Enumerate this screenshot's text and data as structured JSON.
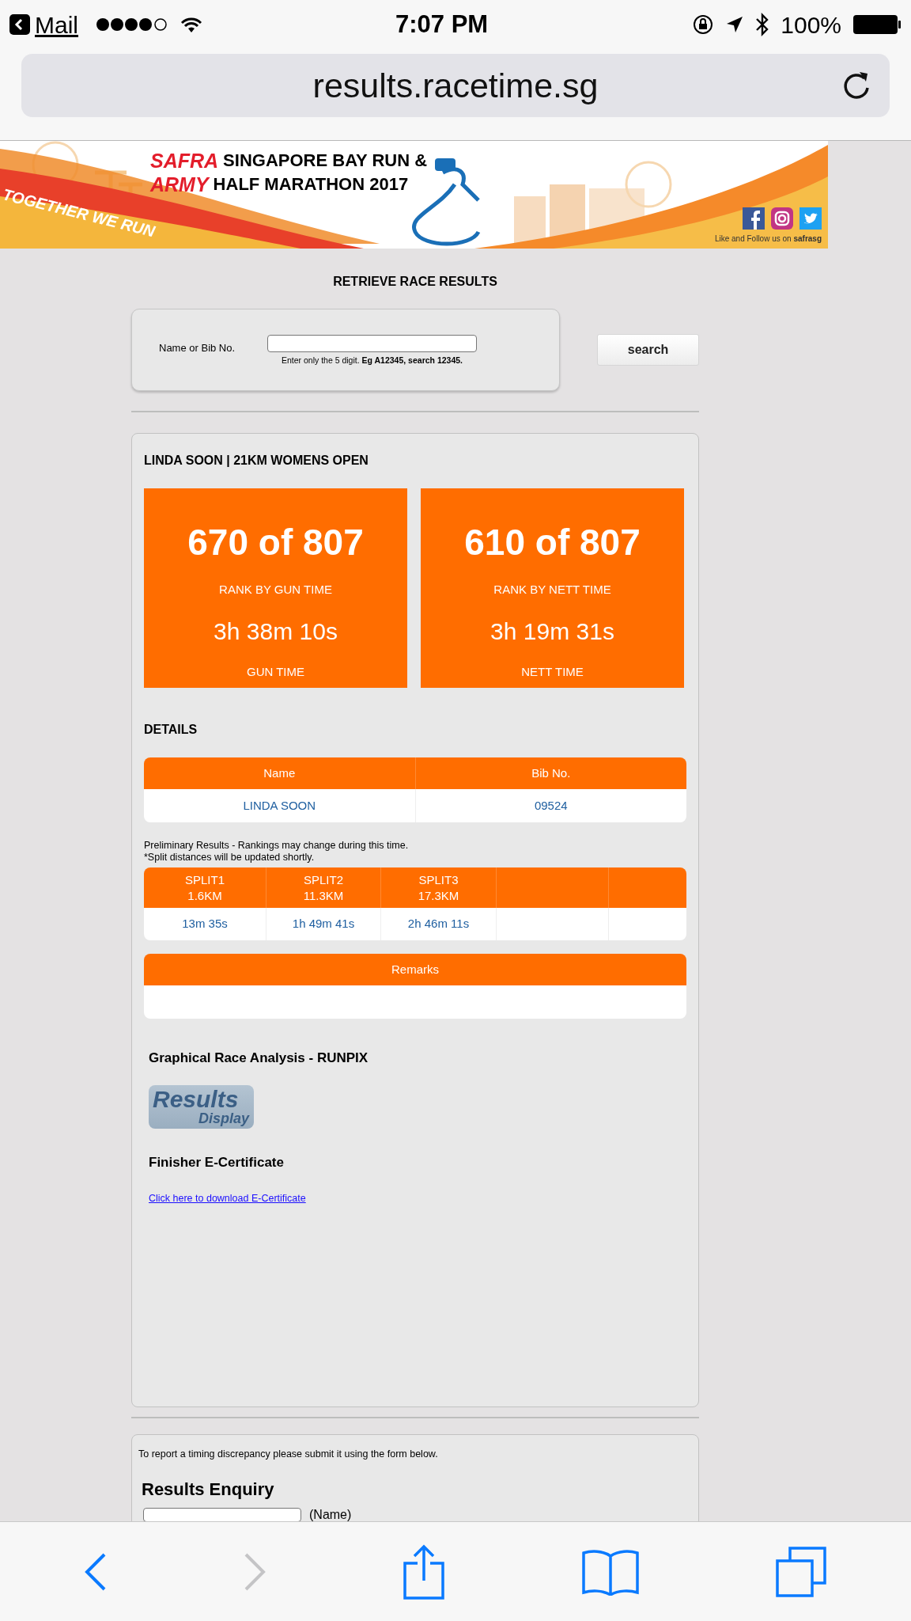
{
  "status_bar": {
    "back_app": "Mail",
    "time": "7:07 PM",
    "battery": "100%"
  },
  "address_bar": {
    "url": "results.racetime.sg"
  },
  "banner": {
    "title_1_red": "SAFRA",
    "title_1": "SINGAPORE BAY RUN &",
    "title_2_red": "ARMY",
    "title_2": "HALF MARATHON 2017",
    "slogan": "TOGETHER WE RUN",
    "follow": "Like and Follow us on **safrasg**"
  },
  "search": {
    "heading": "RETRIEVE RACE RESULTS",
    "label": "Name or Bib No.",
    "hint": "Enter only the 5 digit. **Eg A12345, search 12345.**",
    "button": "search"
  },
  "result": {
    "title": "LINDA SOON | 21KM WOMENS OPEN",
    "stats": [
      {
        "rank": "670 of 807",
        "rank_label": "RANK BY GUN TIME",
        "time": "3h 38m 10s",
        "time_label": "GUN TIME"
      },
      {
        "rank": "610 of 807",
        "rank_label": "RANK BY NETT TIME",
        "time": "3h 19m 31s",
        "time_label": "NETT TIME"
      }
    ],
    "details_heading": "DETAILS",
    "details_table": {
      "columns": [
        "Name",
        "Bib No."
      ],
      "rows": [
        [
          "LINDA SOON",
          "09524"
        ]
      ]
    },
    "notes": [
      "Preliminary Results - Rankings may change during this time.",
      "*Split distances will be updated shortly."
    ],
    "splits": [
      {
        "name": "SPLIT1",
        "distance": "1.6KM",
        "time": "13m 35s"
      },
      {
        "name": "SPLIT2",
        "distance": "11.3KM",
        "time": "1h 49m 41s"
      },
      {
        "name": "SPLIT3",
        "distance": "17.3KM",
        "time": "2h 46m 11s"
      }
    ],
    "remarks_heading": "Remarks",
    "analysis_heading": "Graphical Race Analysis - RUNPIX",
    "analysis_logo": {
      "line_1": "Results",
      "line_2": "Display"
    },
    "certificate_heading": "Finisher E-Certificate",
    "certificate_link": "Click here to download E-Certificate"
  },
  "enquiry": {
    "note": "To report a timing discrepancy please submit it using the form below.",
    "heading": "Results Enquiry",
    "field_label": "(Name)"
  },
  "toolbar": [
    {
      "kind": "back",
      "disabled": false
    },
    {
      "kind": "forward",
      "disabled": true
    },
    {
      "kind": "share",
      "disabled": false
    },
    {
      "kind": "bookmarks",
      "disabled": false
    },
    {
      "kind": "tabs",
      "disabled": false
    }
  ]
}
